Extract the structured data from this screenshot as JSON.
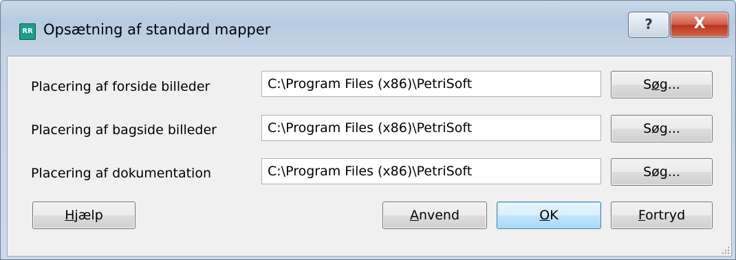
{
  "window": {
    "title": "Opsætning af standard mapper",
    "app_icon_text": "RR",
    "help_glyph": "?",
    "close_glyph": "X"
  },
  "rows": [
    {
      "label": "Placering af forside billeder",
      "value": "C:\\Program Files (x86)\\PetriSoft",
      "browse_pre": "S",
      "browse_mnemonic": "ø",
      "browse_post": "g..."
    },
    {
      "label": "Placering af bagside billeder",
      "value": "C:\\Program Files (x86)\\PetriSoft",
      "browse_pre": "Sø",
      "browse_mnemonic": "g",
      "browse_post": "..."
    },
    {
      "label": "Placering af dokumentation",
      "value": "C:\\Program Files (x86)\\PetriSoft",
      "browse_pre": "Sø",
      "browse_mnemonic": "g",
      "browse_post": "..."
    }
  ],
  "buttons": {
    "help": {
      "mnemonic": "H",
      "rest": "jælp"
    },
    "apply": {
      "mnemonic": "A",
      "rest": "nvend"
    },
    "ok": {
      "mnemonic": "O",
      "rest": "K"
    },
    "cancel": {
      "mnemonic": "F",
      "rest": "ortryd"
    }
  },
  "colors": {
    "titlebar": "#b6cbe1",
    "client_bg": "#f0f0f0",
    "close_red": "#c7422a",
    "default_btn_border": "#3c7fb1",
    "app_icon": "#1a9e8e"
  }
}
